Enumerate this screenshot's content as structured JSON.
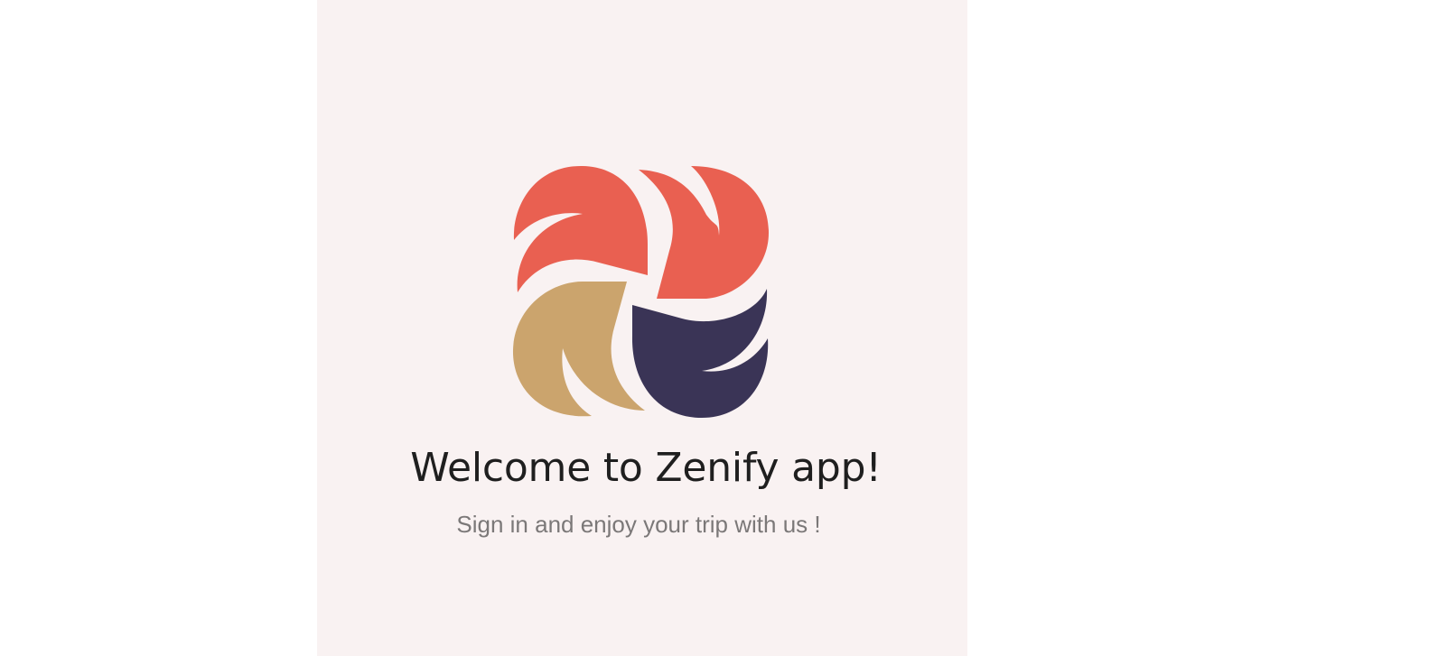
{
  "welcome": {
    "title": "Welcome to Zenify app!",
    "subtitle": "Sign in and enjoy your trip with us !"
  },
  "logo": {
    "icon": "zenify-pinwheel-logo",
    "colors": {
      "coral": "#e96051",
      "tan": "#cba46d",
      "navy": "#3a3456"
    }
  },
  "colors": {
    "panel_background": "#f9f2f2",
    "page_background": "#ffffff",
    "title_text": "#1f1f1f",
    "subtitle_text": "#7b7878"
  }
}
